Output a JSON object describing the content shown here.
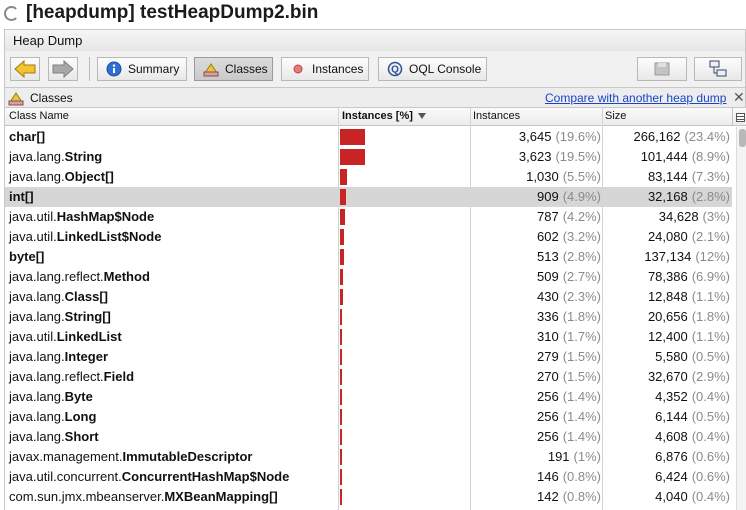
{
  "window": {
    "title": "[heapdump] testHeapDump2.bin"
  },
  "tab": {
    "label": "Heap Dump"
  },
  "toolbar": {
    "back_icon": "arrow-left-icon",
    "forward_icon": "arrow-right-icon",
    "summary_label": "Summary",
    "classes_label": "Classes",
    "instances_label": "Instances",
    "oql_label": "OQL Console"
  },
  "classes_view": {
    "label": "Classes",
    "compare_link": "Compare with another heap dump"
  },
  "table": {
    "columns": {
      "name": "Class Name",
      "instances_pct": "Instances [%]",
      "instances": "Instances",
      "size": "Size"
    },
    "sort_column": "Instances [%]",
    "sort_direction": "descending",
    "selected_row": 3,
    "rows": [
      {
        "pkg": "",
        "cls": "char[]",
        "instances": "3,645",
        "instances_pct": "(19.6%)",
        "instances_fraction": 0.196,
        "size": "266,162",
        "size_pct": "(23.4%)"
      },
      {
        "pkg": "java.lang.",
        "cls": "String",
        "instances": "3,623",
        "instances_pct": "(19.5%)",
        "instances_fraction": 0.195,
        "size": "101,444",
        "size_pct": "(8.9%)"
      },
      {
        "pkg": "java.lang.",
        "cls": "Object[]",
        "instances": "1,030",
        "instances_pct": "(5.5%)",
        "instances_fraction": 0.055,
        "size": "83,144",
        "size_pct": "(7.3%)"
      },
      {
        "pkg": "",
        "cls": "int[]",
        "instances": "909",
        "instances_pct": "(4.9%)",
        "instances_fraction": 0.049,
        "size": "32,168",
        "size_pct": "(2.8%)"
      },
      {
        "pkg": "java.util.",
        "cls": "HashMap$Node",
        "instances": "787",
        "instances_pct": "(4.2%)",
        "instances_fraction": 0.042,
        "size": "34,628",
        "size_pct": "(3%)"
      },
      {
        "pkg": "java.util.",
        "cls": "LinkedList$Node",
        "instances": "602",
        "instances_pct": "(3.2%)",
        "instances_fraction": 0.032,
        "size": "24,080",
        "size_pct": "(2.1%)"
      },
      {
        "pkg": "",
        "cls": "byte[]",
        "instances": "513",
        "instances_pct": "(2.8%)",
        "instances_fraction": 0.028,
        "size": "137,134",
        "size_pct": "(12%)"
      },
      {
        "pkg": "java.lang.reflect.",
        "cls": "Method",
        "instances": "509",
        "instances_pct": "(2.7%)",
        "instances_fraction": 0.027,
        "size": "78,386",
        "size_pct": "(6.9%)"
      },
      {
        "pkg": "java.lang.",
        "cls": "Class[]",
        "instances": "430",
        "instances_pct": "(2.3%)",
        "instances_fraction": 0.023,
        "size": "12,848",
        "size_pct": "(1.1%)"
      },
      {
        "pkg": "java.lang.",
        "cls": "String[]",
        "instances": "336",
        "instances_pct": "(1.8%)",
        "instances_fraction": 0.018,
        "size": "20,656",
        "size_pct": "(1.8%)"
      },
      {
        "pkg": "java.util.",
        "cls": "LinkedList",
        "instances": "310",
        "instances_pct": "(1.7%)",
        "instances_fraction": 0.017,
        "size": "12,400",
        "size_pct": "(1.1%)"
      },
      {
        "pkg": "java.lang.",
        "cls": "Integer",
        "instances": "279",
        "instances_pct": "(1.5%)",
        "instances_fraction": 0.015,
        "size": "5,580",
        "size_pct": "(0.5%)"
      },
      {
        "pkg": "java.lang.reflect.",
        "cls": "Field",
        "instances": "270",
        "instances_pct": "(1.5%)",
        "instances_fraction": 0.015,
        "size": "32,670",
        "size_pct": "(2.9%)"
      },
      {
        "pkg": "java.lang.",
        "cls": "Byte",
        "instances": "256",
        "instances_pct": "(1.4%)",
        "instances_fraction": 0.014,
        "size": "4,352",
        "size_pct": "(0.4%)"
      },
      {
        "pkg": "java.lang.",
        "cls": "Long",
        "instances": "256",
        "instances_pct": "(1.4%)",
        "instances_fraction": 0.014,
        "size": "6,144",
        "size_pct": "(0.5%)"
      },
      {
        "pkg": "java.lang.",
        "cls": "Short",
        "instances": "256",
        "instances_pct": "(1.4%)",
        "instances_fraction": 0.014,
        "size": "4,608",
        "size_pct": "(0.4%)"
      },
      {
        "pkg": "javax.management.",
        "cls": "ImmutableDescriptor",
        "instances": "191",
        "instances_pct": "(1%)",
        "instances_fraction": 0.01,
        "size": "6,876",
        "size_pct": "(0.6%)"
      },
      {
        "pkg": "java.util.concurrent.",
        "cls": "ConcurrentHashMap$Node",
        "instances": "146",
        "instances_pct": "(0.8%)",
        "instances_fraction": 0.008,
        "size": "6,424",
        "size_pct": "(0.6%)"
      },
      {
        "pkg": "com.sun.jmx.mbeanserver.",
        "cls": "MXBeanMapping[]",
        "instances": "142",
        "instances_pct": "(0.8%)",
        "instances_fraction": 0.008,
        "size": "4,040",
        "size_pct": "(0.4%)"
      }
    ]
  },
  "colors": {
    "bar": "#c92424",
    "selected_row": "#d6d6d6",
    "link": "#1a44c8",
    "percent_text": "#8a8a8a"
  }
}
